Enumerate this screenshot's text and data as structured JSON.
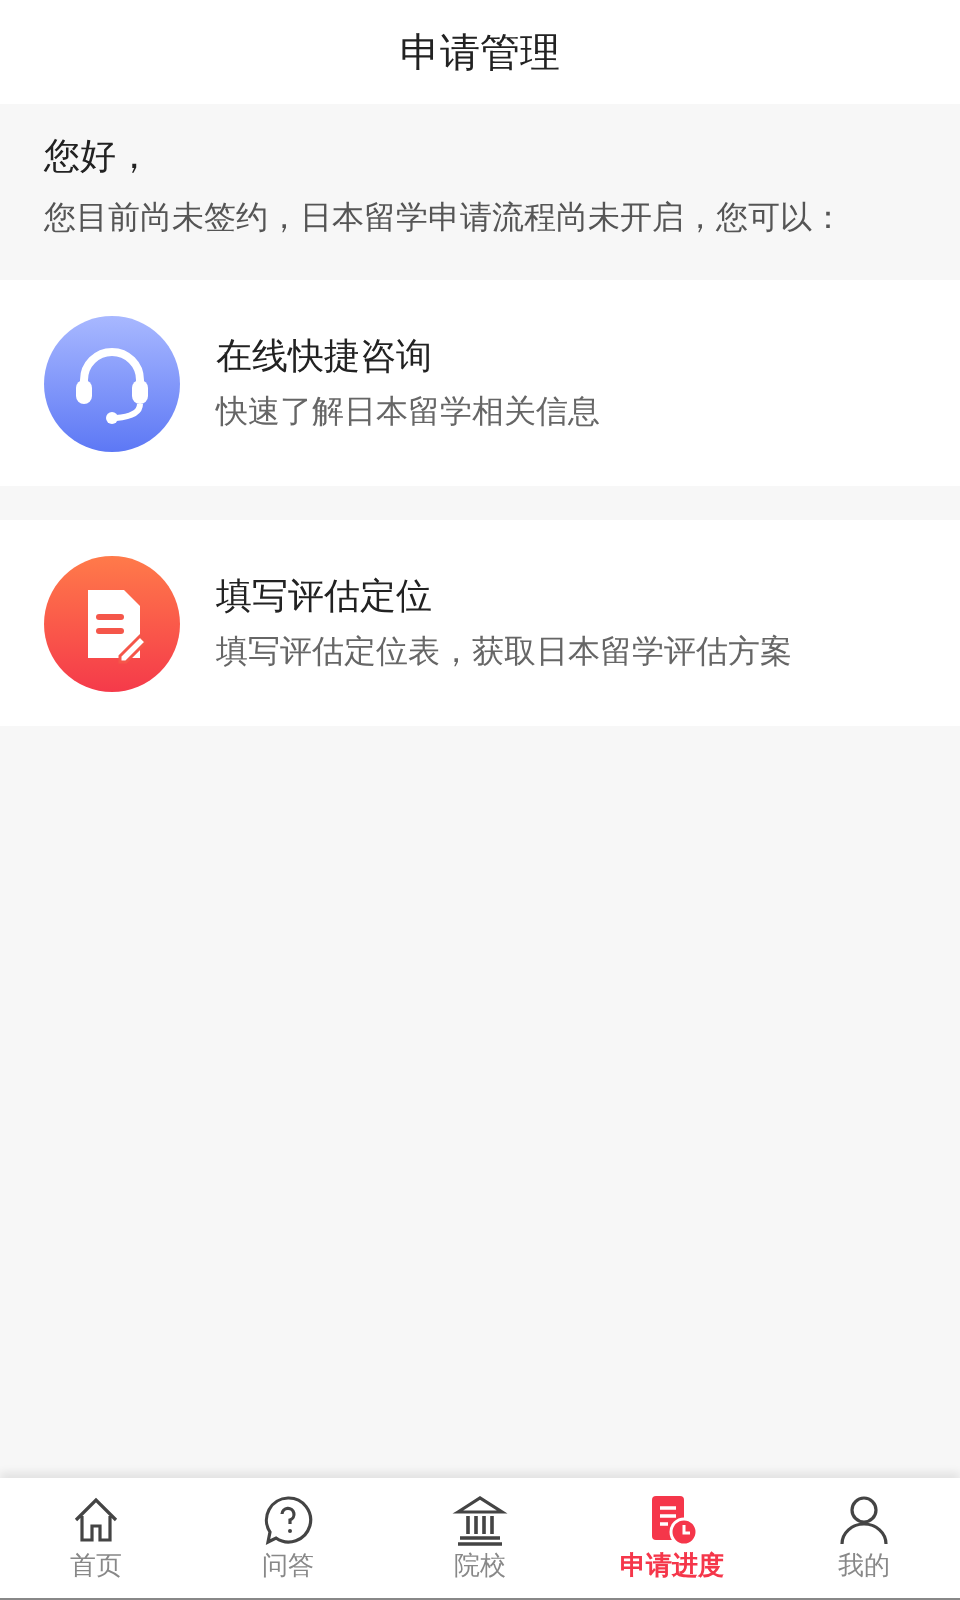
{
  "header": {
    "title": "申请管理"
  },
  "notice": {
    "greeting": "您好，",
    "message": "您目前尚未签约，日本留学申请流程尚未开启，您可以："
  },
  "cards": [
    {
      "kind": "headset",
      "title": "在线快捷咨询",
      "subtitle": "快速了解日本留学相关信息"
    },
    {
      "kind": "form",
      "title": "填写评估定位",
      "subtitle": "填写评估定位表，获取日本留学评估方案"
    }
  ],
  "tab_bar": [
    {
      "kind": "home",
      "label": "首页",
      "selected": false
    },
    {
      "kind": "question",
      "label": "问答",
      "selected": false
    },
    {
      "kind": "school",
      "label": "院校",
      "selected": false
    },
    {
      "kind": "progress",
      "label": "申请进度",
      "selected": true
    },
    {
      "kind": "person",
      "label": "我的",
      "selected": false
    }
  ]
}
